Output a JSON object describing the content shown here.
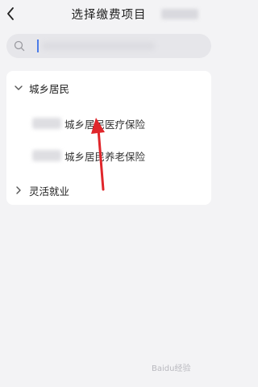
{
  "header": {
    "title": "选择缴费项目",
    "back_icon": "chevron-left-icon"
  },
  "search": {
    "icon": "search-icon"
  },
  "groups": [
    {
      "label": "城乡居民",
      "expanded": true,
      "items": [
        {
          "label": "城乡居民医疗保险"
        },
        {
          "label": "城乡居民养老保险"
        }
      ]
    },
    {
      "label": "灵活就业",
      "expanded": false,
      "items": []
    }
  ],
  "annotation": {
    "color": "#e0262b"
  },
  "watermark": {
    "text": "Baidu经验"
  },
  "colors": {
    "background": "#f3f3f5",
    "card": "#ffffff",
    "search": "#e6e6ea",
    "cursor": "#4a7be8"
  }
}
